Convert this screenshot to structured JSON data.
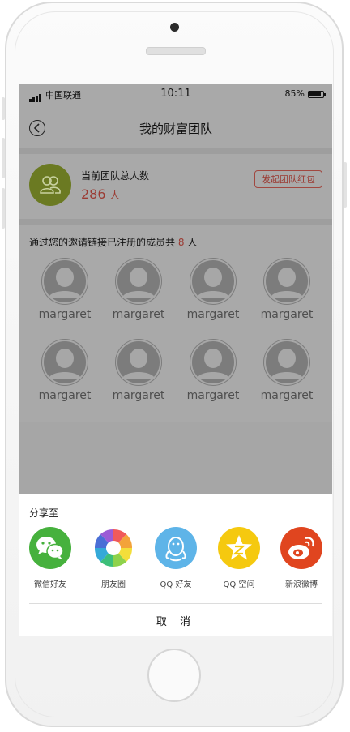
{
  "status_bar": {
    "carrier": "中国联通",
    "time": "10:11",
    "battery": "85%"
  },
  "nav": {
    "title": "我的财富团队",
    "back_icon": "chevron-left-circle-icon"
  },
  "team": {
    "label": "当前团队总人数",
    "count": "286",
    "unit": "人",
    "redpack_button": "发起团队红包",
    "avatar_color": "#6b7a22"
  },
  "members": {
    "intro_prefix": "通过您的邀请链接已注册的成员共",
    "count": "8",
    "intro_suffix": "人",
    "items": [
      {
        "name": "margaret"
      },
      {
        "name": "margaret"
      },
      {
        "name": "margaret"
      },
      {
        "name": "margaret"
      },
      {
        "name": "margaret"
      },
      {
        "name": "margaret"
      },
      {
        "name": "margaret"
      },
      {
        "name": "margaret"
      }
    ]
  },
  "share": {
    "title": "分享至",
    "items": [
      {
        "label": "微信好友",
        "icon": "wechat-icon",
        "color": "#46b13d"
      },
      {
        "label": "朋友圈",
        "icon": "moments-icon",
        "color": "#ffffff"
      },
      {
        "label": "QQ 好友",
        "icon": "qq-icon",
        "color": "#5eb4e8"
      },
      {
        "label": "QQ 空间",
        "icon": "qzone-icon",
        "color": "#f5c90f"
      },
      {
        "label": "新浪微博",
        "icon": "weibo-icon",
        "color": "#e0451f"
      }
    ],
    "cancel": "取 消"
  },
  "colors": {
    "accent_red": "#9b3a32",
    "overlay_gray": "#a9a9a9"
  }
}
